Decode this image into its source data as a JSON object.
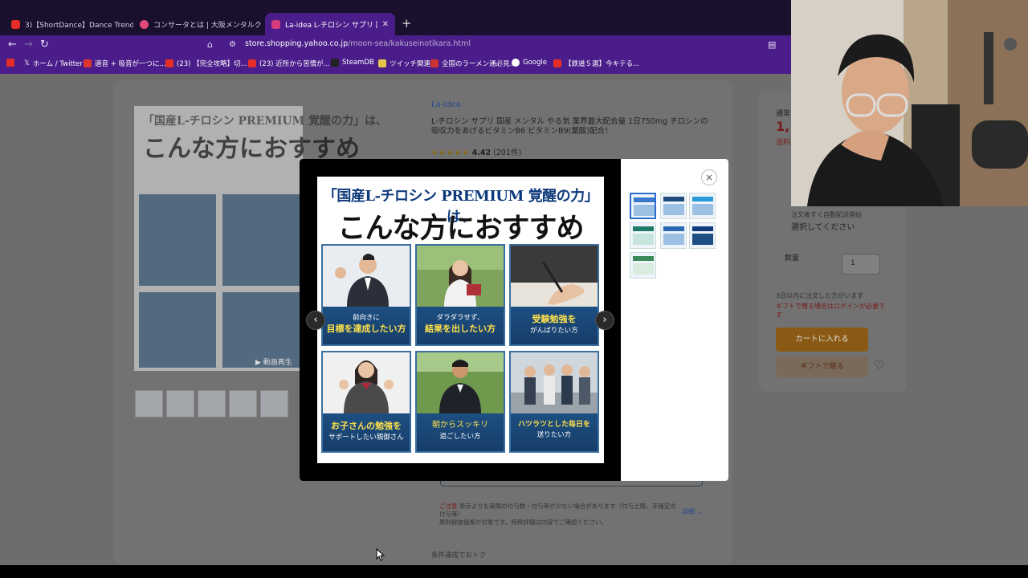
{
  "browser": {
    "tabs": [
      {
        "label": "3)【ShortDance】Dance Trend",
        "color": "#e52d27"
      },
      {
        "label": "コンサータとは | 大阪メンタルクリニック",
        "color": "#e24a7a"
      },
      {
        "label": "La-idea L-チロシン サプリ 国産 メン",
        "color": "#d63c7c"
      }
    ],
    "url_host": "store.shopping.yahoo.co.jp",
    "url_path": "/moon-sea/kakuseinotikara.html",
    "bookmarks": [
      "ホーム / Twitter",
      "適音 + 吸音が一つに...",
      "(23) 【完全攻略】切...",
      "(23) 近所から苦情が...",
      "SteamDB",
      "ツイッチ関連",
      "全国のラーメン通必見...",
      "Google",
      "【鉄道５選】今キテる..."
    ]
  },
  "product": {
    "brand": "La-idea",
    "title": "L-チロシン サプリ 国産 メンタル やる気 業界最大配合量 1日750mg チロシンの吸収力をあげるビタミンB6 ビタミンB9(葉酸)配合！",
    "rating_stars": "★★★★★",
    "rating_value": "4.42",
    "review_count": "(201件)"
  },
  "sidebar": {
    "price_label": "通常",
    "price": "1,",
    "shipping": "送料",
    "select_hint": "注文後すぐ自動配送開始",
    "select_value": "選択してください",
    "qty_label": "数量",
    "qty_value": "1",
    "notice1": "3日以内に注文した方がいます",
    "notice2": "ギフトで贈る場合はログインが必要です",
    "cart_button": "カートに入れる",
    "gift_button": "ギフトで贈る"
  },
  "notes": {
    "caution_label": "ご注意",
    "caution_text": "表示よりも実際の付与数・付与率が少ない場合があります（付与上限、手確定の付与等）",
    "caution_more": "原則税抜価格が対象です。特典詳細は内容でご確認ください。",
    "detail_link": "詳細 ⌄",
    "condition": "条件達成でおトク"
  },
  "modal": {
    "headline1": "「国産L-チロシン PREMIUM 覚醒の力」は、",
    "headline2": "こんな方におすすめ",
    "cells": [
      {
        "line1": "前向きに",
        "line2": "目標を達成したい方"
      },
      {
        "line1": "ダラダラせず、",
        "line2": "結果を出したい方"
      },
      {
        "line1": "受験勉強を",
        "line2": "がんばりたい方"
      },
      {
        "line1": "お子さんの勉強を",
        "line2": "サポートしたい親御さん"
      },
      {
        "line1": "朝からスッキリ",
        "line2": "過ごしたい方"
      },
      {
        "line1": "ハツラツとした毎日を",
        "line2": "送りたい方"
      }
    ],
    "prev_icon": "‹",
    "next_icon": "›",
    "close_icon": "×"
  },
  "background_image": {
    "headline1": "「国産L-チロシン PREMIUM 覚醒の力」は、",
    "headline2": "こんな方におすすめ",
    "video_label": "▶ 動画再生"
  },
  "colors": {
    "tab_bg": "#1b0f2e",
    "chrome_accent": "#4b1d8a",
    "caption_blue": "#1d4f82",
    "accent_yellow": "#ffe14a"
  }
}
